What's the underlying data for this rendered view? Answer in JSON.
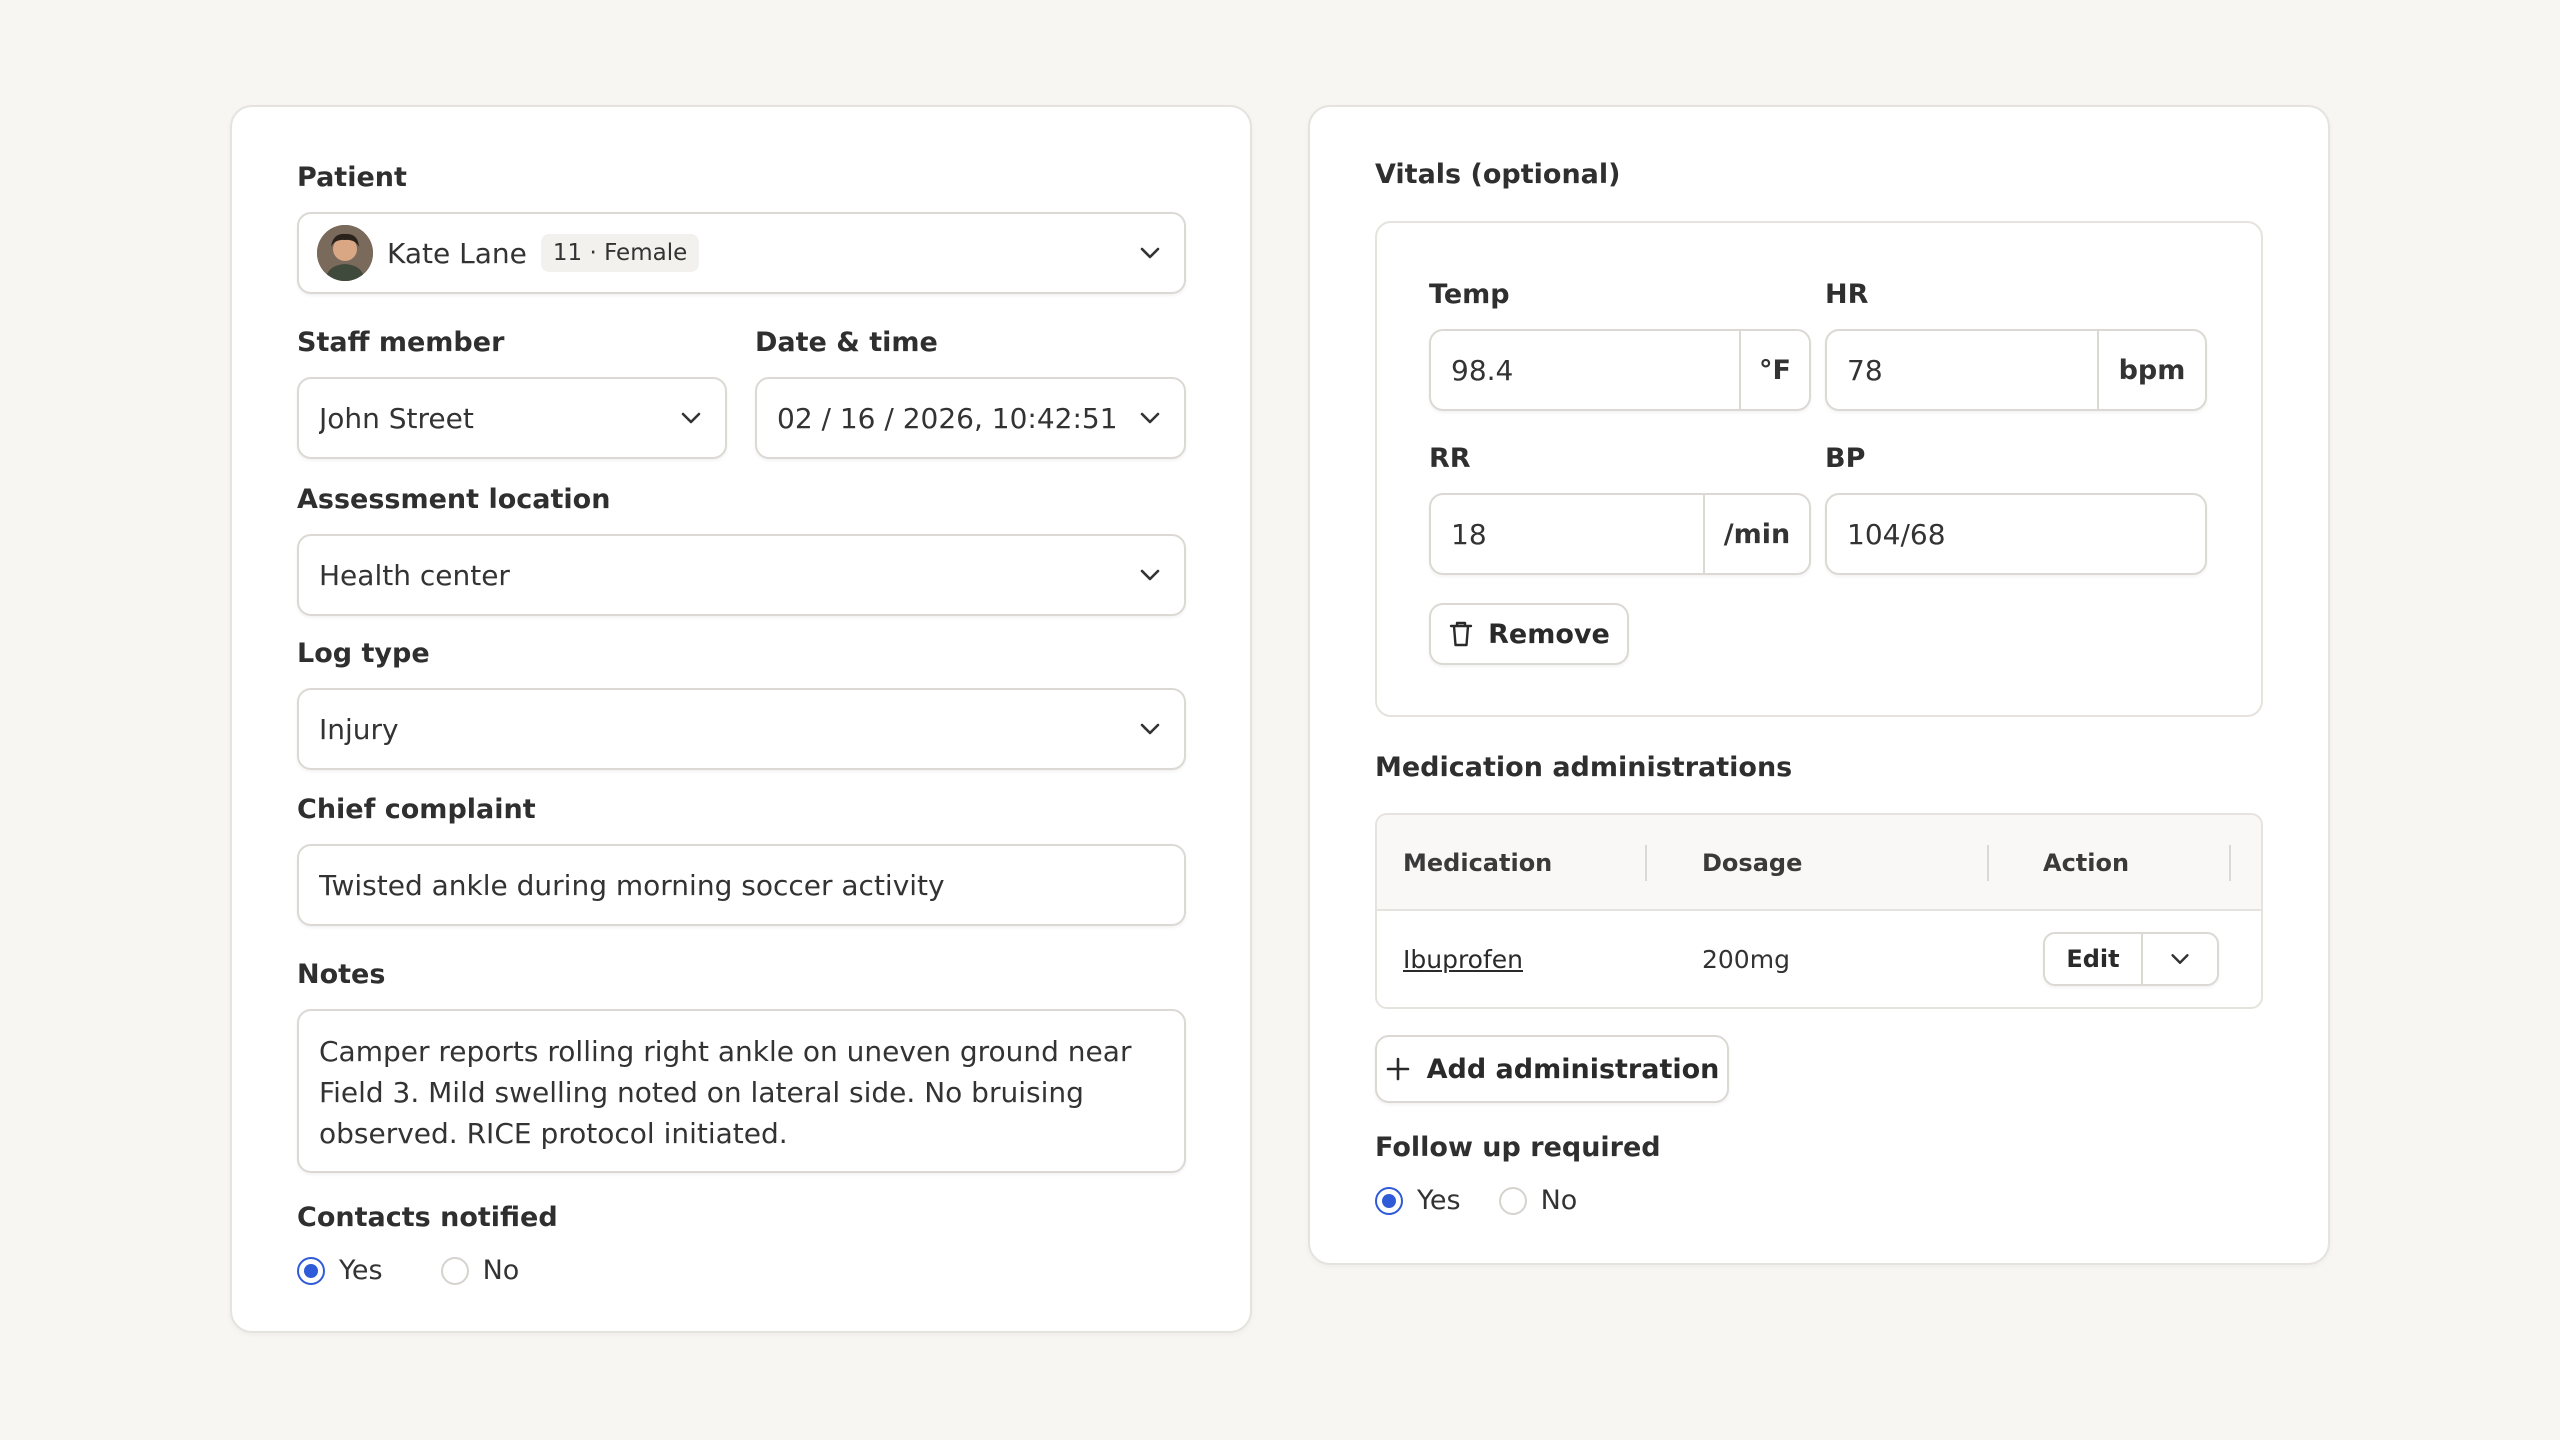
{
  "left": {
    "patient": {
      "label": "Patient",
      "name": "Kate Lane",
      "meta": "11 · Female"
    },
    "staff": {
      "label": "Staff member",
      "value": "John Street"
    },
    "datetime": {
      "label": "Date & time",
      "value": "02 / 16 / 2026, 10:42:51"
    },
    "location": {
      "label": "Assessment location",
      "value": "Health center"
    },
    "log_type": {
      "label": "Log type",
      "value": "Injury"
    },
    "complaint": {
      "label": "Chief complaint",
      "value": "Twisted ankle during morning soccer activity"
    },
    "notes": {
      "label": "Notes",
      "value": "Camper reports rolling right ankle on uneven ground near Field 3. Mild swelling noted on lateral side. No bruising observed. RICE protocol initiated."
    },
    "contacts": {
      "label": "Contacts notified",
      "yes": "Yes",
      "no": "No",
      "selected": "Yes"
    }
  },
  "right": {
    "vitals": {
      "label": "Vitals (optional)",
      "temp": {
        "label": "Temp",
        "value": "98.4",
        "unit": "°F"
      },
      "hr": {
        "label": "HR",
        "value": "78",
        "unit": "bpm"
      },
      "rr": {
        "label": "RR",
        "value": "18",
        "unit": "/min"
      },
      "bp": {
        "label": "BP",
        "value": "104/68"
      },
      "remove_label": "Remove"
    },
    "medications": {
      "label": "Medication administrations",
      "columns": [
        "Medication",
        "Dosage",
        "Action"
      ],
      "rows": [
        {
          "medication": "Ibuprofen",
          "dosage": "200mg",
          "action": "Edit"
        }
      ],
      "add_label": "Add administration"
    },
    "follow_up": {
      "label": "Follow up required",
      "yes": "Yes",
      "no": "No",
      "selected": "Yes"
    }
  },
  "colors": {
    "background": "#f8f6f2",
    "card": "#ffffff",
    "accent": "#2f5bd8",
    "border": "#dcd9d4"
  }
}
